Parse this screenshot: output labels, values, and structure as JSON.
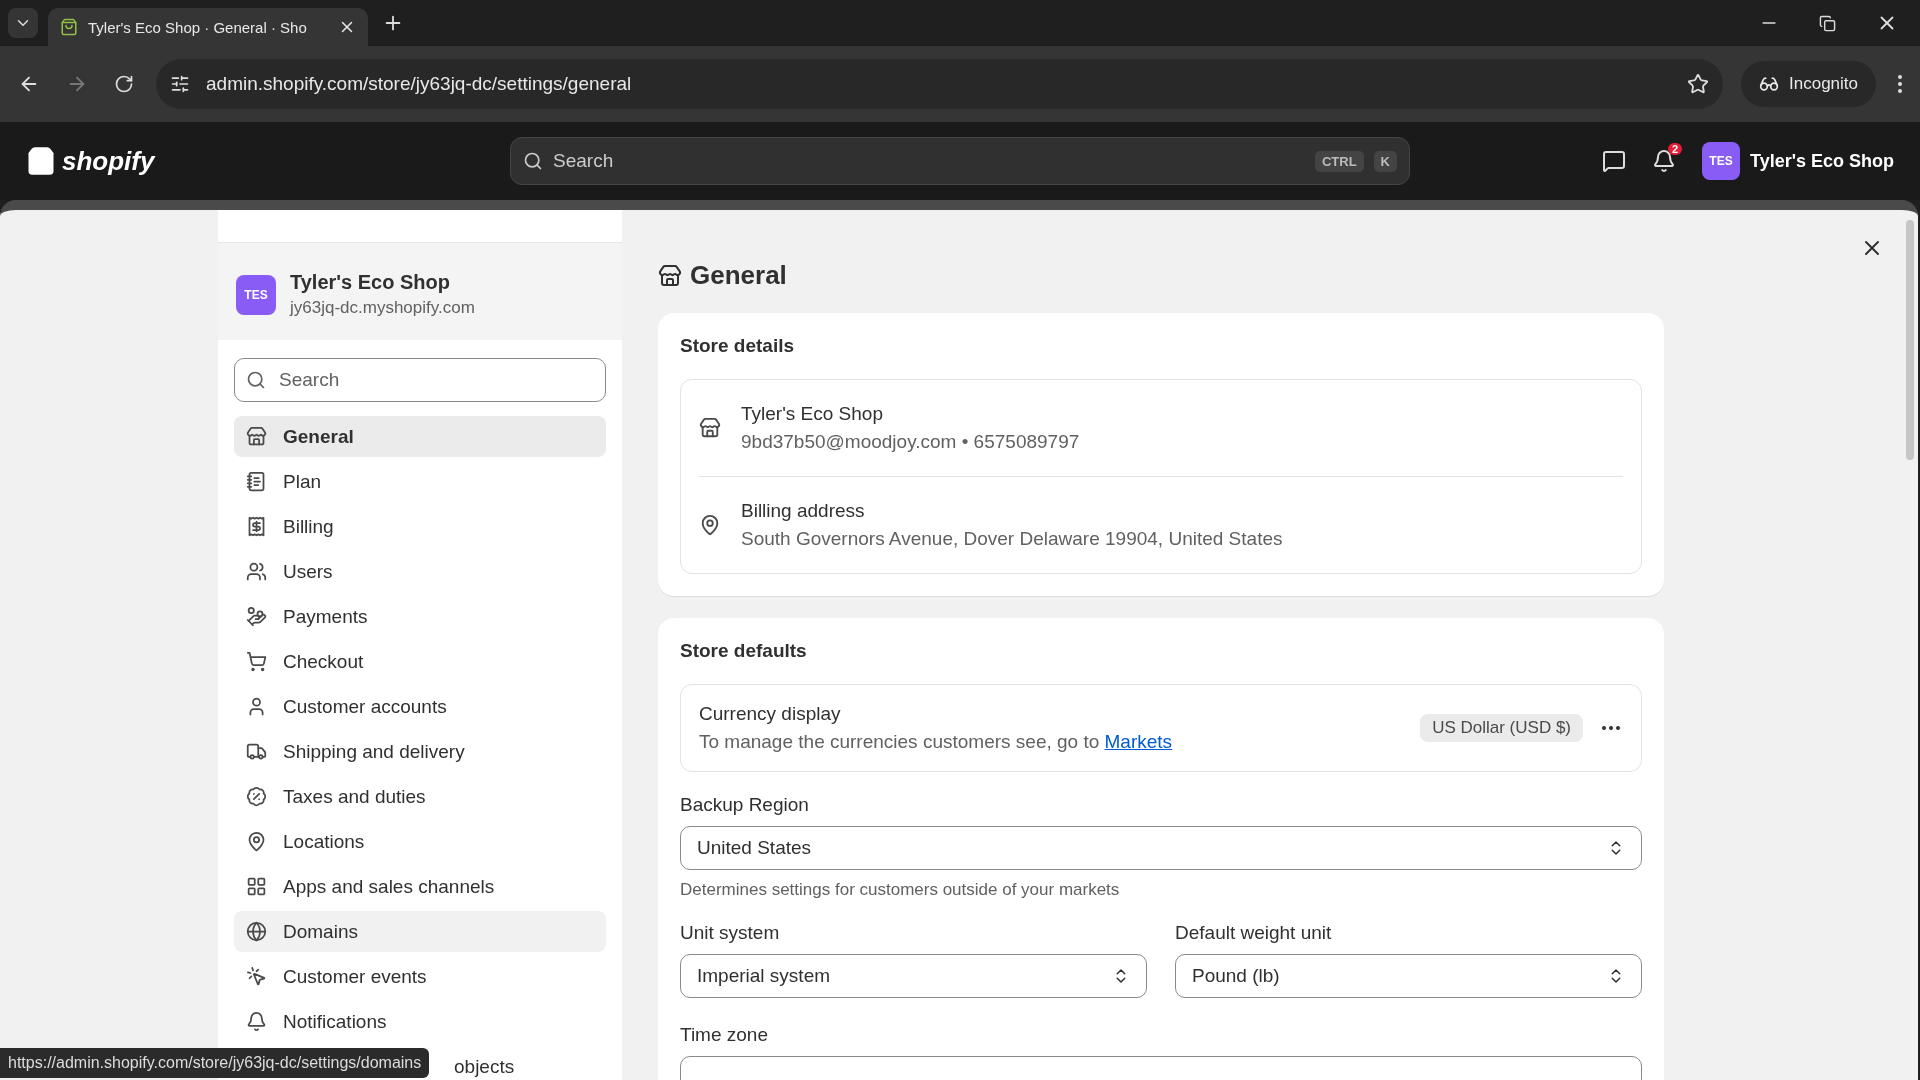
{
  "browser": {
    "tab_title": "Tyler's Eco Shop · General · Sho",
    "url": "admin.shopify.com/store/jy63jq-dc/settings/general",
    "incognito": "Incognito"
  },
  "topbar": {
    "logo": "shopify",
    "search_placeholder": "Search",
    "shortcut_keys": [
      "CTRL",
      "K"
    ],
    "notification_count": "2",
    "avatar": "TES",
    "store_name": "Tyler's Eco Shop"
  },
  "sidebar": {
    "store": {
      "initials": "TES",
      "name": "Tyler's Eco Shop",
      "domain": "jy63jq-dc.myshopify.com"
    },
    "search_placeholder": "Search",
    "items": [
      {
        "label": "General",
        "selected": true,
        "hovered": false,
        "kind": "full"
      },
      {
        "label": "Plan",
        "selected": false,
        "hovered": false,
        "kind": "full"
      },
      {
        "label": "Billing",
        "selected": false,
        "hovered": false,
        "kind": "full"
      },
      {
        "label": "Users",
        "selected": false,
        "hovered": false,
        "kind": "full"
      },
      {
        "label": "Payments",
        "selected": false,
        "hovered": false,
        "kind": "full"
      },
      {
        "label": "Checkout",
        "selected": false,
        "hovered": false,
        "kind": "full"
      },
      {
        "label": "Customer accounts",
        "selected": false,
        "hovered": false,
        "kind": "full"
      },
      {
        "label": "Shipping and delivery",
        "selected": false,
        "hovered": false,
        "kind": "full"
      },
      {
        "label": "Taxes and duties",
        "selected": false,
        "hovered": false,
        "kind": "full"
      },
      {
        "label": "Locations",
        "selected": false,
        "hovered": false,
        "kind": "full"
      },
      {
        "label": "Apps and sales channels",
        "selected": false,
        "hovered": false,
        "kind": "full"
      },
      {
        "label": "Domains",
        "selected": false,
        "hovered": true,
        "kind": "full"
      },
      {
        "label": "Customer events",
        "selected": false,
        "hovered": false,
        "kind": "full"
      },
      {
        "label": "Notifications",
        "selected": false,
        "hovered": false,
        "kind": "full"
      },
      {
        "label": "objects",
        "kind": "covered"
      }
    ]
  },
  "main": {
    "title": "General",
    "store_details": {
      "title": "Store details",
      "rows": [
        {
          "kind": "store",
          "title": "Tyler's Eco Shop",
          "subtitle": "9bd37b50@moodjoy.com • 6575089797"
        },
        {
          "kind": "address",
          "title": "Billing address",
          "subtitle": "South Governors Avenue, Dover Delaware 19904, United States"
        }
      ]
    },
    "store_defaults": {
      "title": "Store defaults",
      "currency": {
        "title": "Currency display",
        "description": "To manage the currencies customers see, go to",
        "link": "Markets",
        "badge": "US Dollar (USD $)"
      },
      "backup_region": {
        "label": "Backup Region",
        "value": "United States",
        "help": "Determines settings for customers outside of your markets"
      },
      "unit_system": {
        "label": "Unit system",
        "value": "Imperial system"
      },
      "weight_unit": {
        "label": "Default weight unit",
        "value": "Pound (lb)"
      },
      "time_zone": {
        "label": "Time zone"
      }
    }
  },
  "status_bar": {
    "url": "https://admin.shopify.com/store/jy63jq-dc/settings/domains"
  }
}
